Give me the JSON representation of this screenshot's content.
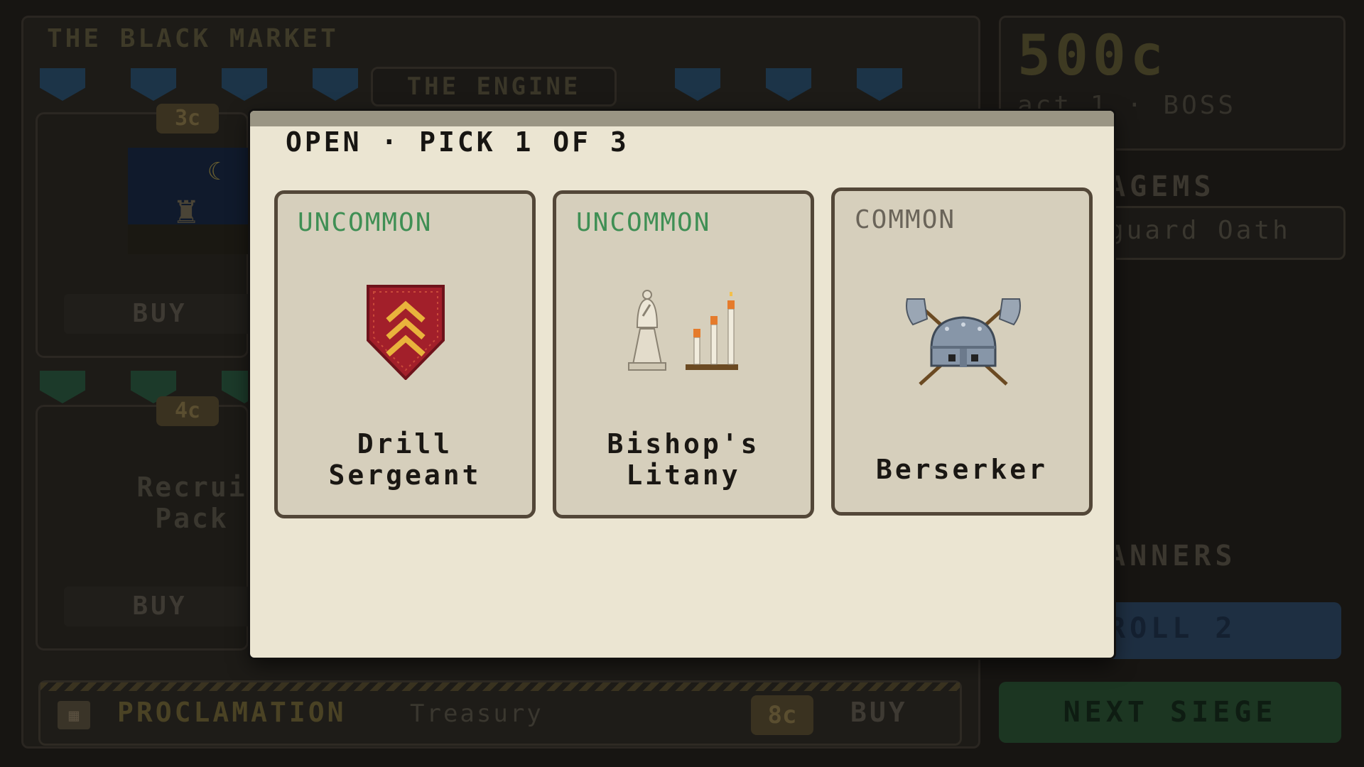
{
  "market": {
    "title": "THE BLACK MARKET",
    "engine_tag": "THE ENGINE",
    "cards": [
      {
        "price": "3c",
        "buy_label": "BUY"
      },
      {
        "price": "4c",
        "name_line1": "Recrui",
        "name_line2": "Pack",
        "buy_label": "BUY"
      }
    ],
    "proclamation": {
      "title": "PROCLAMATION",
      "subtitle": "Treasury",
      "price": "8c",
      "buy_label": "BUY"
    }
  },
  "sidebar": {
    "coins": "500c",
    "act": "act 1 · BOSS",
    "stratagems_label": "AGEMS",
    "oath_label": "guard Oath",
    "banners_label": "ANNERS",
    "reroll_label": "ROLL 2",
    "next_siege_label": "NEXT SIEGE"
  },
  "modal": {
    "title": "OPEN · PICK 1 OF 3",
    "cards": [
      {
        "rarity": "UNCOMMON",
        "name_line1": "Drill",
        "name_line2": "Sergeant",
        "icon": "chevron-shield-icon"
      },
      {
        "rarity": "UNCOMMON",
        "name_line1": "Bishop's",
        "name_line2": "Litany",
        "icon": "bishop-candles-icon"
      },
      {
        "rarity": "COMMON",
        "name_line1": "Berserker",
        "icon": "horned-helmet-axes-icon"
      }
    ]
  },
  "colors": {
    "uncommon": "#3f8f54",
    "common": "#6a6459",
    "modal_bg": "#ebe5d2",
    "card_bg": "#d6cfbc",
    "card_border": "#534738"
  }
}
